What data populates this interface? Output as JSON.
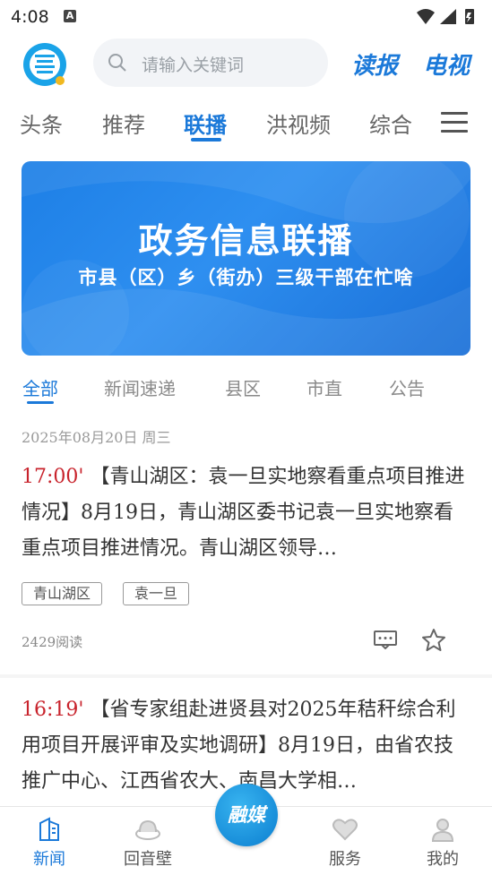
{
  "status_bar": {
    "time": "4:08",
    "notification": "A"
  },
  "header": {
    "search_placeholder": "请输入关键词",
    "dubao_label": "读报",
    "tv_label": "电视"
  },
  "tabs": [
    {
      "label": "头条"
    },
    {
      "label": "推荐"
    },
    {
      "label": "联播",
      "active": true
    },
    {
      "label": "洪视频"
    },
    {
      "label": "综合"
    }
  ],
  "banner": {
    "title": "政务信息联播",
    "subtitle": "市县（区）乡（街办）三级干部在忙啥"
  },
  "subtabs": [
    {
      "label": "全部",
      "active": true
    },
    {
      "label": "新闻速递"
    },
    {
      "label": "县区"
    },
    {
      "label": "市直"
    },
    {
      "label": "公告"
    }
  ],
  "feed": {
    "date": "2025年08月20日 周三",
    "items": [
      {
        "time": "17:00'",
        "text": "【青山湖区：袁一旦实地察看重点项目推进情况】8月19日，青山湖区委书记袁一旦实地察看重点项目推进情况。青山湖区领导…",
        "tags": [
          "青山湖区",
          "袁一旦"
        ],
        "reads": "2429阅读"
      },
      {
        "time": "16:19'",
        "text": "【省专家组赴进贤县对2025年秸秆综合利用项目开展评审及实地调研】8月19日，由省农技推广中心、江西省农大、南昌大学相…"
      }
    ]
  },
  "bottom_nav": {
    "items": [
      {
        "label": "新闻",
        "active": true
      },
      {
        "label": "回音壁"
      },
      {
        "label": "融媒"
      },
      {
        "label": "服务"
      },
      {
        "label": "我的"
      }
    ]
  },
  "colors": {
    "accent": "#1b79d9",
    "time_red": "#c8232c"
  }
}
